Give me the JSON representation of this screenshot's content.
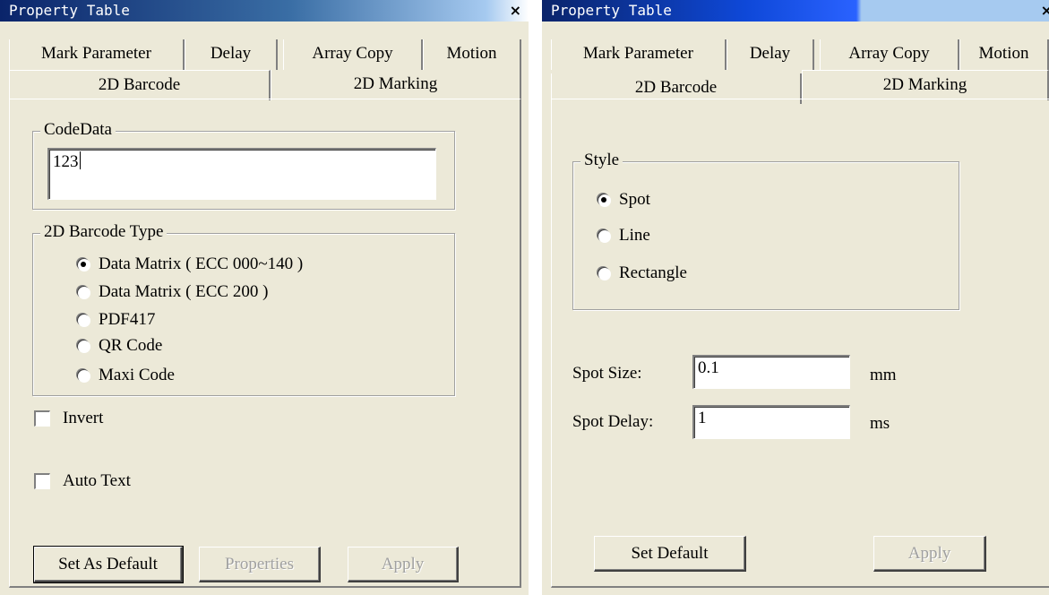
{
  "left_panel": {
    "title": "Property Table",
    "close_glyph": "×",
    "tabs_row1": [
      "Mark Parameter",
      "Delay",
      "Array Copy",
      "Motion"
    ],
    "tabs_row2": [
      "2D Barcode",
      "2D Marking"
    ],
    "selected_tab": "2D Barcode",
    "code_data": {
      "legend": "CodeData",
      "value": "123"
    },
    "barcode_type": {
      "legend": "2D Barcode Type",
      "options": [
        "Data Matrix ( ECC 000~140 )",
        "Data Matrix ( ECC 200 )",
        "PDF417",
        "QR Code",
        "Maxi Code"
      ],
      "selected": "Data Matrix ( ECC 000~140 )"
    },
    "invert": {
      "label": "Invert",
      "checked": false
    },
    "auto_text": {
      "label": "Auto Text",
      "checked": false
    },
    "buttons": {
      "set_as_default": "Set As Default",
      "properties": "Properties",
      "apply": "Apply"
    }
  },
  "right_panel": {
    "title": "Property Table",
    "close_glyph": "×",
    "tabs_row1": [
      "Mark Parameter",
      "Delay",
      "Array Copy",
      "Motion"
    ],
    "tabs_row2": [
      "2D Barcode",
      "2D Marking"
    ],
    "selected_tab": "2D Marking",
    "style": {
      "legend": "Style",
      "options": [
        "Spot",
        "Line",
        "Rectangle"
      ],
      "selected": "Spot"
    },
    "spot_size": {
      "label": "Spot Size:",
      "value": "0.1",
      "unit": "mm"
    },
    "spot_delay": {
      "label": "Spot Delay:",
      "value": "1",
      "unit": "ms"
    },
    "buttons": {
      "set_default": "Set Default",
      "apply": "Apply"
    }
  }
}
